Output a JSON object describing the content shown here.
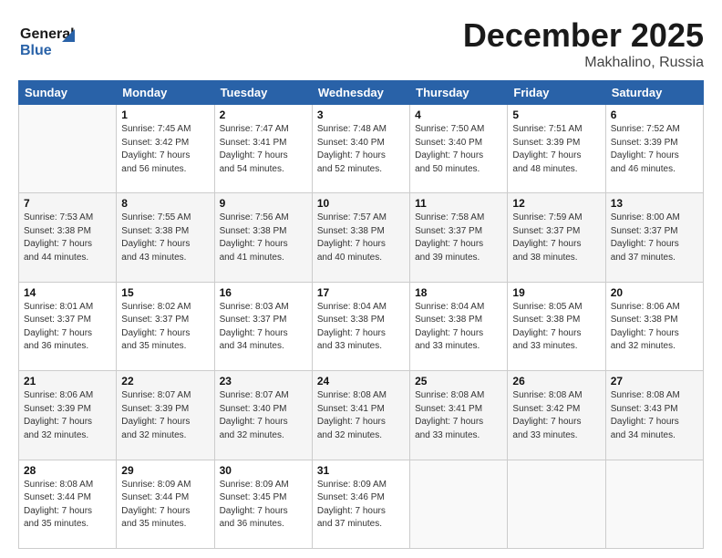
{
  "header": {
    "logo_line1": "General",
    "logo_line2": "Blue",
    "month": "December 2025",
    "location": "Makhalino, Russia"
  },
  "days_of_week": [
    "Sunday",
    "Monday",
    "Tuesday",
    "Wednesday",
    "Thursday",
    "Friday",
    "Saturday"
  ],
  "weeks": [
    [
      {
        "day": "",
        "info": ""
      },
      {
        "day": "1",
        "info": "Sunrise: 7:45 AM\nSunset: 3:42 PM\nDaylight: 7 hours\nand 56 minutes."
      },
      {
        "day": "2",
        "info": "Sunrise: 7:47 AM\nSunset: 3:41 PM\nDaylight: 7 hours\nand 54 minutes."
      },
      {
        "day": "3",
        "info": "Sunrise: 7:48 AM\nSunset: 3:40 PM\nDaylight: 7 hours\nand 52 minutes."
      },
      {
        "day": "4",
        "info": "Sunrise: 7:50 AM\nSunset: 3:40 PM\nDaylight: 7 hours\nand 50 minutes."
      },
      {
        "day": "5",
        "info": "Sunrise: 7:51 AM\nSunset: 3:39 PM\nDaylight: 7 hours\nand 48 minutes."
      },
      {
        "day": "6",
        "info": "Sunrise: 7:52 AM\nSunset: 3:39 PM\nDaylight: 7 hours\nand 46 minutes."
      }
    ],
    [
      {
        "day": "7",
        "info": "Sunrise: 7:53 AM\nSunset: 3:38 PM\nDaylight: 7 hours\nand 44 minutes."
      },
      {
        "day": "8",
        "info": "Sunrise: 7:55 AM\nSunset: 3:38 PM\nDaylight: 7 hours\nand 43 minutes."
      },
      {
        "day": "9",
        "info": "Sunrise: 7:56 AM\nSunset: 3:38 PM\nDaylight: 7 hours\nand 41 minutes."
      },
      {
        "day": "10",
        "info": "Sunrise: 7:57 AM\nSunset: 3:38 PM\nDaylight: 7 hours\nand 40 minutes."
      },
      {
        "day": "11",
        "info": "Sunrise: 7:58 AM\nSunset: 3:37 PM\nDaylight: 7 hours\nand 39 minutes."
      },
      {
        "day": "12",
        "info": "Sunrise: 7:59 AM\nSunset: 3:37 PM\nDaylight: 7 hours\nand 38 minutes."
      },
      {
        "day": "13",
        "info": "Sunrise: 8:00 AM\nSunset: 3:37 PM\nDaylight: 7 hours\nand 37 minutes."
      }
    ],
    [
      {
        "day": "14",
        "info": "Sunrise: 8:01 AM\nSunset: 3:37 PM\nDaylight: 7 hours\nand 36 minutes."
      },
      {
        "day": "15",
        "info": "Sunrise: 8:02 AM\nSunset: 3:37 PM\nDaylight: 7 hours\nand 35 minutes."
      },
      {
        "day": "16",
        "info": "Sunrise: 8:03 AM\nSunset: 3:37 PM\nDaylight: 7 hours\nand 34 minutes."
      },
      {
        "day": "17",
        "info": "Sunrise: 8:04 AM\nSunset: 3:38 PM\nDaylight: 7 hours\nand 33 minutes."
      },
      {
        "day": "18",
        "info": "Sunrise: 8:04 AM\nSunset: 3:38 PM\nDaylight: 7 hours\nand 33 minutes."
      },
      {
        "day": "19",
        "info": "Sunrise: 8:05 AM\nSunset: 3:38 PM\nDaylight: 7 hours\nand 33 minutes."
      },
      {
        "day": "20",
        "info": "Sunrise: 8:06 AM\nSunset: 3:38 PM\nDaylight: 7 hours\nand 32 minutes."
      }
    ],
    [
      {
        "day": "21",
        "info": "Sunrise: 8:06 AM\nSunset: 3:39 PM\nDaylight: 7 hours\nand 32 minutes."
      },
      {
        "day": "22",
        "info": "Sunrise: 8:07 AM\nSunset: 3:39 PM\nDaylight: 7 hours\nand 32 minutes."
      },
      {
        "day": "23",
        "info": "Sunrise: 8:07 AM\nSunset: 3:40 PM\nDaylight: 7 hours\nand 32 minutes."
      },
      {
        "day": "24",
        "info": "Sunrise: 8:08 AM\nSunset: 3:41 PM\nDaylight: 7 hours\nand 32 minutes."
      },
      {
        "day": "25",
        "info": "Sunrise: 8:08 AM\nSunset: 3:41 PM\nDaylight: 7 hours\nand 33 minutes."
      },
      {
        "day": "26",
        "info": "Sunrise: 8:08 AM\nSunset: 3:42 PM\nDaylight: 7 hours\nand 33 minutes."
      },
      {
        "day": "27",
        "info": "Sunrise: 8:08 AM\nSunset: 3:43 PM\nDaylight: 7 hours\nand 34 minutes."
      }
    ],
    [
      {
        "day": "28",
        "info": "Sunrise: 8:08 AM\nSunset: 3:44 PM\nDaylight: 7 hours\nand 35 minutes."
      },
      {
        "day": "29",
        "info": "Sunrise: 8:09 AM\nSunset: 3:44 PM\nDaylight: 7 hours\nand 35 minutes."
      },
      {
        "day": "30",
        "info": "Sunrise: 8:09 AM\nSunset: 3:45 PM\nDaylight: 7 hours\nand 36 minutes."
      },
      {
        "day": "31",
        "info": "Sunrise: 8:09 AM\nSunset: 3:46 PM\nDaylight: 7 hours\nand 37 minutes."
      },
      {
        "day": "",
        "info": ""
      },
      {
        "day": "",
        "info": ""
      },
      {
        "day": "",
        "info": ""
      }
    ]
  ]
}
